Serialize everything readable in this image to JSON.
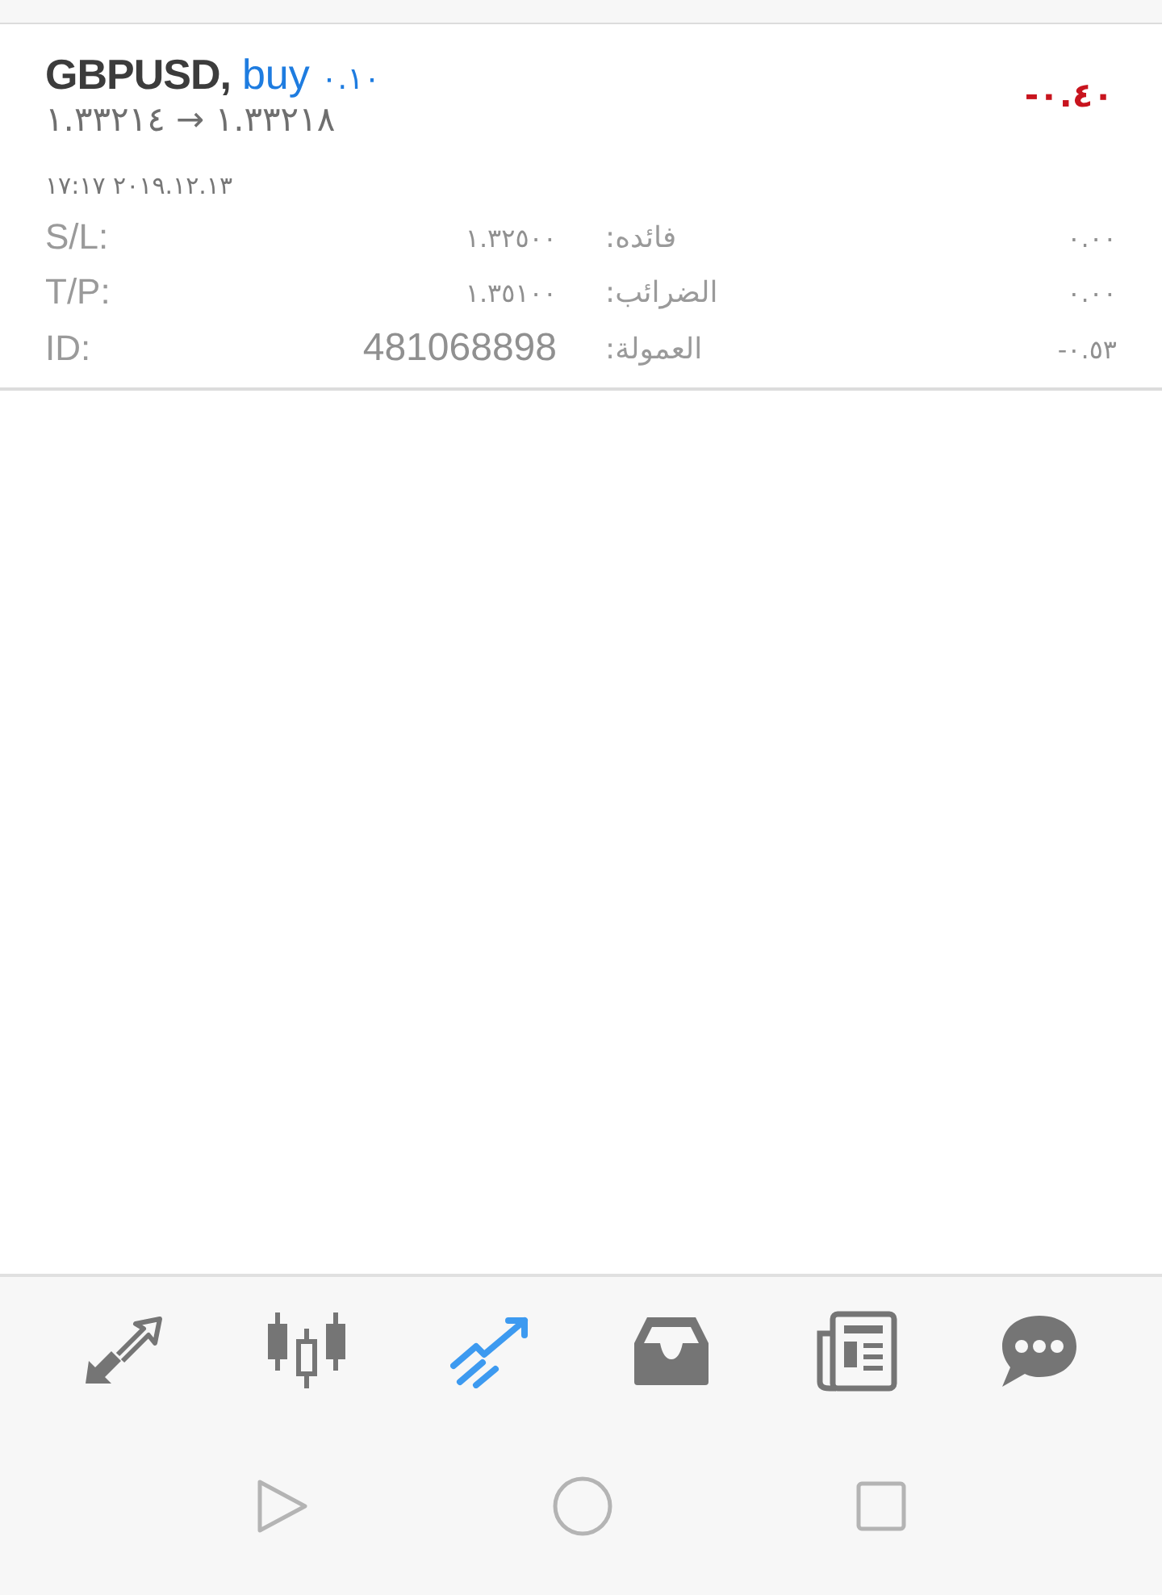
{
  "order": {
    "symbol": "GBPUSD,",
    "side": "buy",
    "volume": "٠.١٠",
    "prices": "١.٣٣٢١٤ → ١.٣٣٢١٨",
    "profit": "-٠.٤٠",
    "time": "١٧:١٧ ٢٠١٩.١٢.١٣",
    "fields": [
      {
        "label": "S/L:",
        "value": "١.٣٢٥٠٠",
        "label2": "فائده:",
        "value2": "٠.٠٠"
      },
      {
        "label": "T/P:",
        "value": "١.٣٥١٠٠",
        "label2": "الضرائب:",
        "value2": "٠.٠٠"
      },
      {
        "label": "ID:",
        "value": "481068898",
        "label2": "العمولة:",
        "value2": "-٠.٥٣"
      }
    ]
  },
  "nav_tabs": [
    {
      "kind": "trade",
      "selected": false
    },
    {
      "kind": "chart",
      "selected": false
    },
    {
      "kind": "history",
      "selected": true
    },
    {
      "kind": "mailbox",
      "selected": false
    },
    {
      "kind": "news",
      "selected": false
    },
    {
      "kind": "chat",
      "selected": false
    }
  ],
  "system_nav": [
    {
      "kind": "back"
    },
    {
      "kind": "home"
    },
    {
      "kind": "recents"
    }
  ]
}
